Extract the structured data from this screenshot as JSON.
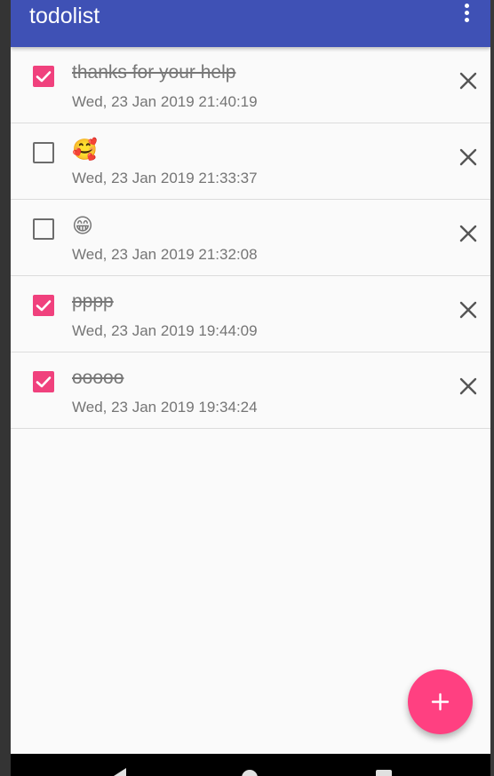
{
  "app_bar": {
    "title": "todolist",
    "menu_icon": "more-vert-icon",
    "color": "#3f51b5"
  },
  "todos": [
    {
      "title": "thanks for your help",
      "date": "Wed, 23 Jan 2019 21:40:19",
      "checked": true
    },
    {
      "title": "🥰",
      "date": "Wed, 23 Jan 2019 21:33:37",
      "checked": false
    },
    {
      "title": "😁",
      "date": "Wed, 23 Jan 2019 21:32:08",
      "checked": false
    },
    {
      "title": "pppp",
      "date": "Wed, 23 Jan 2019 19:44:09",
      "checked": true
    },
    {
      "title": "ooooo",
      "date": "Wed, 23 Jan 2019 19:34:24",
      "checked": true
    }
  ],
  "icons": {
    "delete": "close-icon",
    "fab": "add-icon"
  },
  "colors": {
    "accent": "#ff4081",
    "checkbox_checked": "#f0417d",
    "text_secondary": "#757575"
  },
  "nav_bar": {
    "back_icon": "back-icon",
    "home_icon": "home-icon",
    "recents_icon": "recents-icon"
  }
}
